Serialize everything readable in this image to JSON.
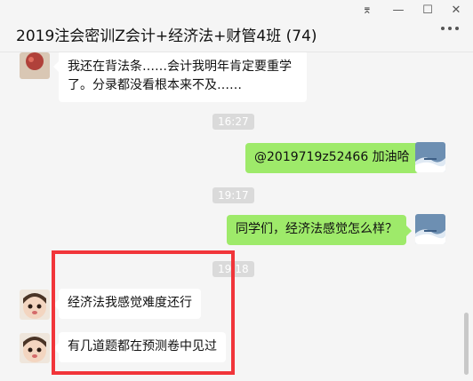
{
  "window": {
    "title": "2019注会密训Z会计+经济法+财管4班 (74)",
    "controls": {
      "pin": "⌆",
      "minimize": "—",
      "maximize": "☐",
      "close": "✕"
    }
  },
  "messages": [
    {
      "type": "incoming",
      "text": "我还在背法条……会计我明年肯定要重学了。分录都没看根本来不及……"
    },
    {
      "type": "time",
      "text": "16:27"
    },
    {
      "type": "outgoing",
      "text": "@2019719z52466 加油哈"
    },
    {
      "type": "time",
      "text": "19:17"
    },
    {
      "type": "outgoing",
      "text": "同学们，经济法感觉怎么样？"
    },
    {
      "type": "time",
      "text": "19:18"
    },
    {
      "type": "incoming",
      "text": "经济法我感觉难度还行"
    },
    {
      "type": "incoming",
      "text": "有几道题都在预测卷中见过"
    }
  ],
  "colors": {
    "highlight": "#f1353a",
    "outgoing_bubble": "#9eea6a"
  }
}
